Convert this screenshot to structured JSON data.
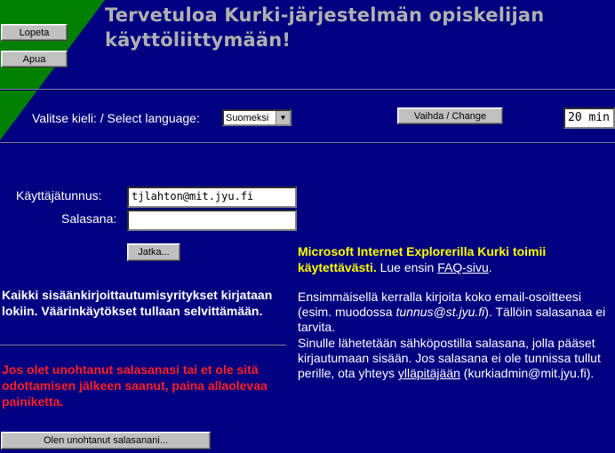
{
  "header": {
    "title": "Tervetuloa Kurki-järjestelmän opiskelijan käyttöliittymään!",
    "quit_button": "Lopeta",
    "help_button": "Apua"
  },
  "language": {
    "label": "Valitse kieli: / Select language:",
    "selected": "Suomeksi",
    "change_button": "Vaihda / Change",
    "timeout": "20 min"
  },
  "login": {
    "username_label": "Käyttäjätunnus:",
    "username_value": "tjlahton@mit.jyu.fi",
    "password_label": "Salasana:",
    "password_value": "",
    "continue_button": "Jatka...",
    "logging_notice": "Kaikki sisäänkirjoittautumisyritykset kirjataan lokiin. Väärinkäytökset tullaan selvittämään.",
    "forgot_notice": "Jos olet unohtanut salasanasi tai et ole sitä odottamisen jälkeen saanut, paina allaolevaa painiketta.",
    "forgot_button": "Olen unohtanut salasanani..."
  },
  "info": {
    "ie_highlight": "Microsoft Internet Explorerilla Kurki toimii käytettävästi.",
    "ie_read_first": "Lue ensin",
    "faq_link": "FAQ-sivu",
    "faq_after": ".",
    "first_time_1": "Ensimmäisellä kerralla kirjoita koko email-osoitteesi (esim. muodossa",
    "first_time_example": "tunnus@st.jyu.fi",
    "first_time_2": "). Tällöin salasanaa ei tarvita.",
    "email_sent_1": "Sinulle lähetetään sähköpostilla salasana, jolla pääset kirjautumaan sisään. Jos salasana ei ole tunnissa tullut perille, ota yhteys",
    "admin_link": "ylläpitäjään",
    "admin_email": "(kurkiadmin@mit.jyu.fi)."
  }
}
